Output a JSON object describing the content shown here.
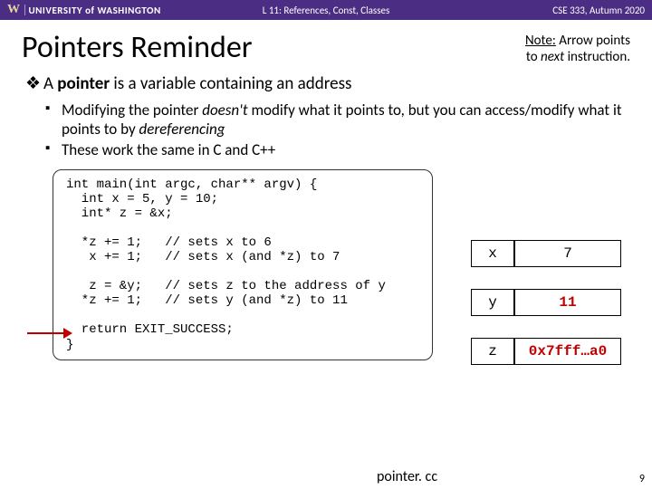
{
  "header": {
    "org": "UNIVERSITY of WASHINGTON",
    "center": "L 11:  References, Const, Classes",
    "right": "CSE 333, Autumn 2020"
  },
  "title": "Pointers Reminder",
  "note": {
    "l1": "Note:",
    "l2": " Arrow points",
    "l3": "to ",
    "l3i": "next",
    "l3b": " instruction."
  },
  "b1": {
    "a": "A ",
    "b": "pointer",
    "c": " is a variable containing an address"
  },
  "b2a": {
    "a": "Modifying the pointer ",
    "b": "doesn't",
    "c": " modify what it points to, but you can access/modify what it points to by ",
    "d": "dereferencing"
  },
  "b2b": "These work the same in C and C++",
  "code": "int main(int argc, char** argv) {\n  int x = 5, y = 10;\n  int* z = &x;\n\n  *z += 1;   // sets x to 6\n   x += 1;   // sets x (and *z) to 7\n\n   z = &y;   // sets z to the address of y\n  *z += 1;   // sets y (and *z) to 11\n\n  return EXIT_SUCCESS;\n}",
  "mem": {
    "x": {
      "name": "x",
      "val": "7"
    },
    "y": {
      "name": "y",
      "val": "11"
    },
    "z": {
      "name": "z",
      "val": "0x7fff…a0"
    }
  },
  "filename": "pointer. cc",
  "pagenum": "9"
}
